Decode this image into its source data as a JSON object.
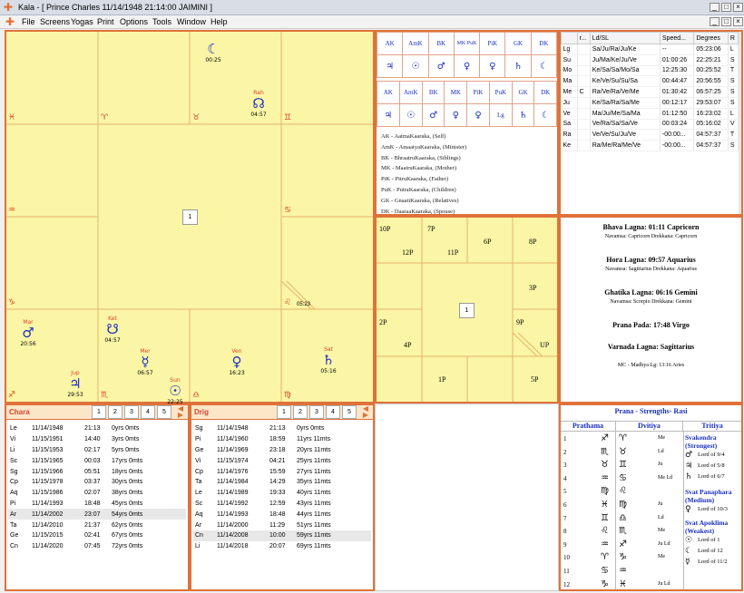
{
  "window": {
    "title": "Kala - [ Prince Charles  11/14/1948  21:14:00        JAIMINI ]"
  },
  "menu": [
    "File",
    "Screens",
    "Yogas",
    "Print",
    "Options",
    "Tools",
    "Window",
    "Help"
  ],
  "chart": {
    "center": "1",
    "signs": [
      "♈",
      "♉",
      "♊",
      "♋",
      "♌",
      "♍",
      "♎",
      "♏",
      "♐",
      "♑",
      "♒",
      "♓"
    ],
    "planets": {
      "moon": {
        "glyph": "☾",
        "deg": "00:25"
      },
      "rahu": {
        "glyph": "☊",
        "deg": "04:57"
      },
      "asc": {
        "deg": "05:23"
      },
      "mars": {
        "glyph": "♂",
        "name": "Mar",
        "deg": "20:56"
      },
      "ketu": {
        "glyph": "☋",
        "name": "Ket",
        "deg": "04:57"
      },
      "jup": {
        "glyph": "♃",
        "name": "Jup",
        "deg": "29:53"
      },
      "mer": {
        "glyph": "☿",
        "name": "Mer",
        "deg": "06:57"
      },
      "sun": {
        "glyph": "☉",
        "name": "Sun",
        "deg": "22:25"
      },
      "ven": {
        "glyph": "♀",
        "name": "Ven",
        "deg": "16:23"
      },
      "sat": {
        "glyph": "♄",
        "name": "Sat",
        "deg": "05:16"
      }
    }
  },
  "karaka": {
    "hdr1": [
      "AK",
      "AmK",
      "BK",
      "MK PuK",
      "PiK",
      "GK",
      "DK"
    ],
    "row1": [
      "♃",
      "☉",
      "♂",
      "♀",
      "♀",
      "♄",
      "☾"
    ],
    "hdr2": [
      "AK",
      "AmK",
      "BK",
      "MK",
      "PiK",
      "PuK",
      "GK",
      "DK"
    ],
    "row2": [
      "♃",
      "☉",
      "♂",
      "♀",
      "♀",
      "Lg",
      "♄",
      "☾"
    ],
    "legend": [
      "AK - AatmaKaaraka, (Self)",
      "AmK - AmaatyaKaaraka, (Minister)",
      "BK - BhraatruKaaraka, (Siblings)",
      "MK - MaatruKaaraka, (Mother)",
      "PiK - PitruKaaraka, (Father)",
      "PuK - PutraKaaraka, (Children)",
      "GK - GnaatiKaaraka, (Relatives)",
      "DK - DaaraaKaaraka, (Spouse)"
    ]
  },
  "planettable": {
    "cols": [
      "",
      "r...",
      "Ld/SL",
      "Speed...",
      "Degrees",
      "R"
    ],
    "rows": [
      [
        "Lg",
        "",
        "Sa/Ju/Ra/Ju/Ke",
        "--",
        "05:23:06",
        "L"
      ],
      [
        "Su",
        "",
        "Ju/Ma/Ke/Ju/Ve",
        "01:00:26",
        "22:25:21",
        "S"
      ],
      [
        "Mo",
        "",
        "Ke/Sa/Sa/Mo/Sa",
        "12:25:30",
        "00:25:52",
        "T"
      ],
      [
        "Ma",
        "",
        "Ke/Ve/Su/Su/Sa",
        "00:44:47",
        "20:56:55",
        "S"
      ],
      [
        "Me",
        "C",
        "Ra/Ve/Ra/Ve/Me",
        "01:30:42",
        "06:57:25",
        "S"
      ],
      [
        "Ju",
        "",
        "Ke/Sa/Ra/Sa/Me",
        "00:12:17",
        "29:53:07",
        "S"
      ],
      [
        "Ve",
        "",
        "Ma/Ju/Me/Sa/Ma",
        "01:12:50",
        "16:23:02",
        "L"
      ],
      [
        "Sa",
        "",
        "Ve/Ra/Sa/Sa/Ve",
        "00:03:24",
        "05:16:02",
        "V"
      ],
      [
        "Ra",
        "",
        "Ve/Ve/Su/Ju/Ve",
        "-00:00...",
        "04:57:37",
        "T"
      ],
      [
        "Ke",
        "",
        "Ra/Me/Ra/Me/Ve",
        "-00:00...",
        "04:57:37",
        "S"
      ]
    ]
  },
  "houses": {
    "labels": [
      "10P",
      "7P",
      "6P",
      "8P",
      "12P",
      "11P",
      "3P",
      "2P",
      "9P",
      "4P",
      "UP",
      "1P",
      "5P"
    ],
    "center": "1"
  },
  "lagnas": [
    {
      "title": "Bhava Lagna: 01:11 Capricorn",
      "sub": "Navamsa: Capricorn  Drekkana: Capricorn"
    },
    {
      "title": "Hora Lagna: 09:57 Aquarius",
      "sub": "Navamsa: Sagittarius  Drekkana: Aquarius"
    },
    {
      "title": "Ghatika Lagna: 06:16 Gemini",
      "sub": "Navamsa: Scorpio  Drekkana: Gemini"
    },
    {
      "title": "Prana Pada: 17:48 Virgo",
      "sub": ""
    },
    {
      "title": "Varnada Lagna: Sagittarius",
      "sub": ""
    },
    {
      "title": "",
      "sub": "MC - Madhya Lg: 13:16 Aries"
    }
  ],
  "chara": {
    "title": "Chara",
    "pages": [
      "1",
      "2",
      "3",
      "4",
      "5"
    ],
    "rows": [
      [
        "Le",
        "11/14/1948",
        "21:13",
        "0yrs 0mts"
      ],
      [
        "Vi",
        "11/15/1951",
        "14:40",
        "3yrs 0mts"
      ],
      [
        "Li",
        "11/15/1953",
        "02:17",
        "5yrs 0mts"
      ],
      [
        "Sc",
        "11/15/1965",
        "00:03",
        "17yrs 0mts"
      ],
      [
        "Sg",
        "11/15/1966",
        "05:51",
        "18yrs 0mts"
      ],
      [
        "Cp",
        "11/15/1978",
        "03:37",
        "30yrs 0mts"
      ],
      [
        "Aq",
        "11/15/1986",
        "02:07",
        "38yrs 0mts"
      ],
      [
        "Pi",
        "11/14/1993",
        "18:48",
        "45yrs 0mts"
      ],
      [
        "Ar",
        "11/14/2002",
        "23:07",
        "54yrs 0mts"
      ],
      [
        "Ta",
        "11/14/2010",
        "21:37",
        "62yrs 0mts"
      ],
      [
        "Ge",
        "11/15/2015",
        "02:41",
        "67yrs 0mts"
      ],
      [
        "Cn",
        "11/14/2020",
        "07:45",
        "72yrs 0mts"
      ]
    ]
  },
  "drig": {
    "title": "Drig",
    "pages": [
      "1",
      "2",
      "3",
      "4",
      "5"
    ],
    "rows": [
      [
        "Sg",
        "11/14/1948",
        "21:13",
        "0yrs 0mts"
      ],
      [
        "Pi",
        "11/14/1960",
        "18:59",
        "11yrs 11mts"
      ],
      [
        "Ge",
        "11/14/1969",
        "23:18",
        "20yrs 11mts"
      ],
      [
        "Vi",
        "11/15/1974",
        "04:21",
        "25yrs 11mts"
      ],
      [
        "Cp",
        "11/14/1976",
        "15:59",
        "27yrs 11mts"
      ],
      [
        "Ta",
        "11/14/1984",
        "14:29",
        "35yrs 11mts"
      ],
      [
        "Le",
        "11/14/1989",
        "19:33",
        "40yrs 11mts"
      ],
      [
        "Sc",
        "11/14/1992",
        "12:59",
        "43yrs 11mts"
      ],
      [
        "Aq",
        "11/14/1993",
        "18:48",
        "44yrs 11mts"
      ],
      [
        "Ar",
        "11/14/2000",
        "11:29",
        "51yrs 11mts"
      ],
      [
        "Cn",
        "11/14/2008",
        "10:00",
        "59yrs 11mts"
      ],
      [
        "Li",
        "11/14/2018",
        "20:07",
        "69yrs 11mts"
      ]
    ]
  },
  "prana": {
    "title": "Prana - Strengths- Rasi",
    "cols": [
      "Prathama",
      "Dvitiya",
      "Tritiya"
    ],
    "rows": [
      [
        "1",
        "♐",
        "♈",
        "Me"
      ],
      [
        "2",
        "♏",
        "♉",
        "Ld"
      ],
      [
        "3",
        "♉",
        "♊",
        "Ju"
      ],
      [
        "4",
        "♒",
        "♋",
        "Me  Ld"
      ],
      [
        "5",
        "♍",
        "♌",
        ""
      ],
      [
        "6",
        "♓",
        "♍",
        "Ju"
      ],
      [
        "7",
        "♊",
        "♎",
        "Ld"
      ],
      [
        "8",
        "♌",
        "♏",
        "Me"
      ],
      [
        "9",
        "♒",
        "♐",
        "Ju  Ld"
      ],
      [
        "10",
        "♈",
        "♑",
        "Me"
      ],
      [
        "11",
        "♋",
        "♒",
        ""
      ],
      [
        "12",
        "♑",
        "♓",
        "Ju  Ld"
      ]
    ],
    "strongest": {
      "title": "Svakendra (Strongest)",
      "items": [
        [
          "♂",
          "Lord of  9/4"
        ],
        [
          "♃",
          "Lord of  5/8"
        ],
        [
          "♄",
          "Lord of  6/7"
        ]
      ]
    },
    "medium": {
      "title": "Svat Panaphara (Medium)",
      "items": [
        [
          "♀",
          "Lord of 10/3"
        ]
      ]
    },
    "weakest": {
      "title": "Svat Apoklima (Weakest)",
      "items": [
        [
          "☉",
          "Lord of  1"
        ],
        [
          "☾",
          "Lord of  12"
        ],
        [
          "☿",
          "Lord of 11/2"
        ]
      ]
    }
  }
}
